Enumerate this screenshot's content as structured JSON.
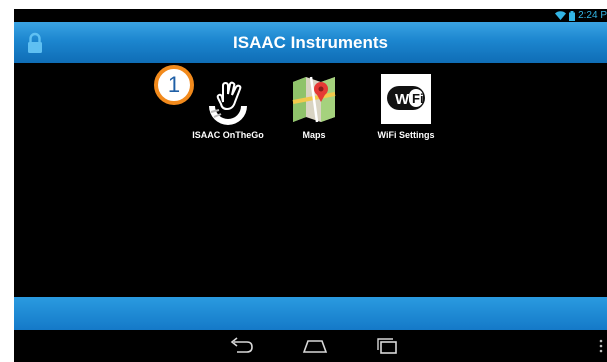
{
  "status": {
    "time": "2:24 P"
  },
  "actionbar": {
    "title": "ISAAC Instruments"
  },
  "apps": [
    {
      "label": "ISAAC OnTheGo",
      "icon": "isaac-onthego-icon"
    },
    {
      "label": "Maps",
      "icon": "maps-icon"
    },
    {
      "label": "WiFi Settings",
      "icon": "wifi-settings-icon"
    }
  ],
  "badge": {
    "text": "1"
  },
  "nav": {
    "back": "back-icon",
    "home": "home-icon",
    "recents": "recents-icon",
    "menu": "overflow-menu-icon"
  },
  "colors": {
    "accent": "#1c86cf",
    "badge_border": "#f28a1c",
    "badge_text": "#1f5fa6"
  }
}
